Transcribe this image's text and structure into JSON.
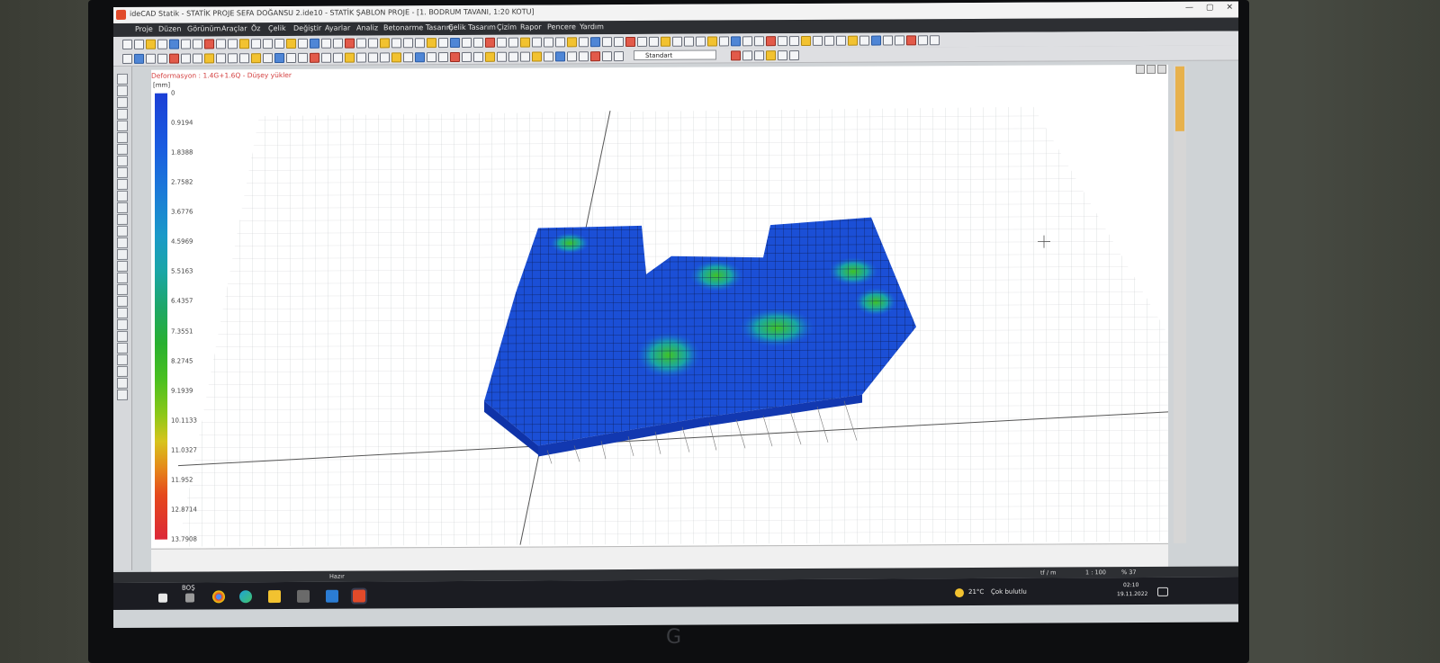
{
  "window": {
    "title": "ideCAD Statik - STATİK PROJE SEFA DOĞANSU 2.ide10 - STATİK ŞABLON PROJE - [1. BODRUM TAVANI,  1:20 KOTU]",
    "minimize": "—",
    "maximize": "▢",
    "close": "✕"
  },
  "menu": {
    "items": [
      "Proje",
      "Düzen",
      "Görünüm",
      "Araçlar",
      "Öz",
      "Çelik",
      "Değiştir",
      "Ayarlar",
      "Analiz",
      "Betonarme Tasarım",
      "Çelik Tasarım",
      "Çizim",
      "Rapor",
      "Pencere",
      "Yardım"
    ]
  },
  "toolbar": {
    "style_value": "Standart"
  },
  "viewport": {
    "header": "Deformasyon : 1.4G+1.6Q  -  Düşey yükler",
    "unit": "[mm]"
  },
  "legend": {
    "labels": [
      "0",
      "0.9194",
      "1.8388",
      "2.7582",
      "3.6776",
      "4.5969",
      "5.5163",
      "6.4357",
      "7.3551",
      "8.2745",
      "9.1939",
      "10.1133",
      "11.0327",
      "11.952",
      "12.8714",
      "13.7908"
    ]
  },
  "status": {
    "left": "Hazır",
    "unit": "tf / m",
    "scale": "1 : 100",
    "zoom": "% 37"
  },
  "taskbar": {
    "search": "BOŞ",
    "weather_temp": "21°C",
    "weather_desc": "Çok bulutlu",
    "time": "02:10",
    "date": "19.11.2022"
  },
  "colors": {
    "accent": "#e7b14c",
    "menu_bg": "#2d2f33",
    "deform_low": "#1b3fd6",
    "deform_mid": "#28b030",
    "deform_high": "#dc2838"
  },
  "icons": [
    "app-icon",
    "windows-start-icon",
    "task-view-icon",
    "chrome-icon",
    "edge-icon",
    "file-explorer-icon",
    "store-icon",
    "mail-icon",
    "idecad-icon",
    "weather-icon",
    "notification-icon"
  ]
}
